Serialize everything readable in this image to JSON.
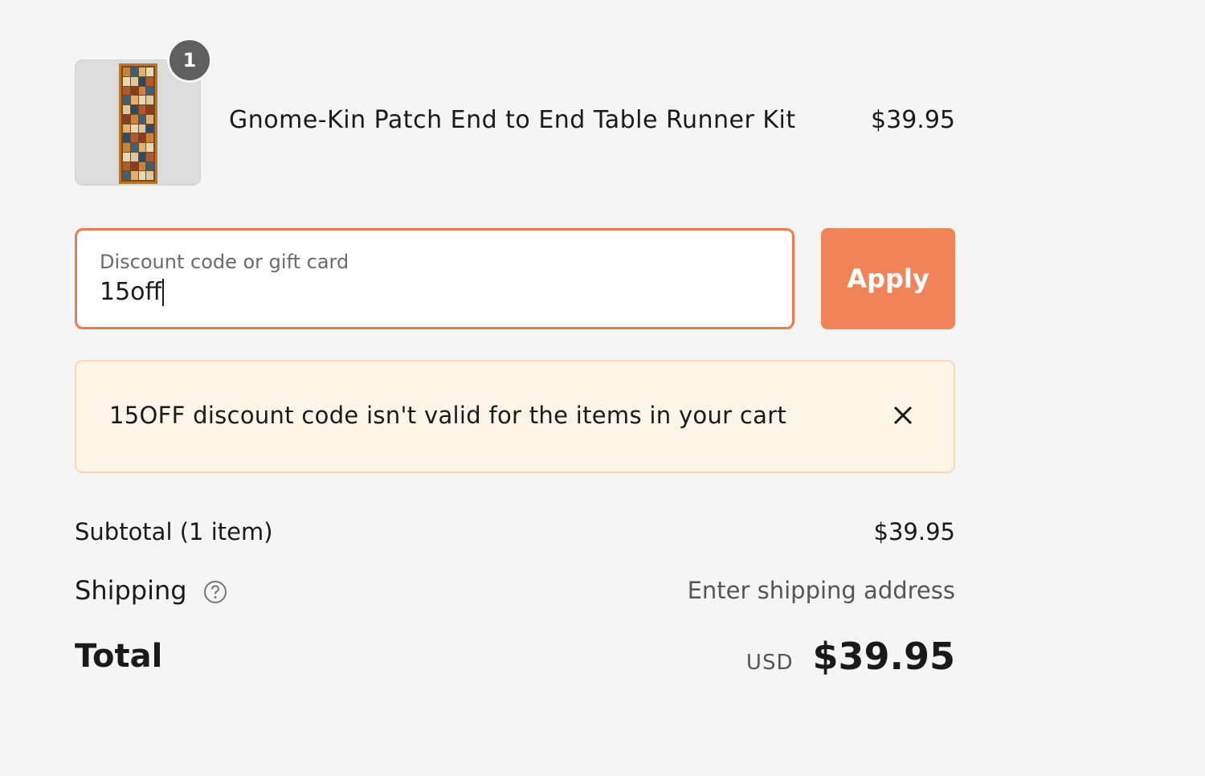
{
  "line_item": {
    "quantity": "1",
    "title": "Gnome-Kin Patch End to End Table Runner Kit",
    "price": "$39.95"
  },
  "discount": {
    "label": "Discount code or gift card",
    "value": "15off",
    "apply_label": "Apply"
  },
  "error": {
    "message": "15OFF discount code isn't valid for the items in your cart"
  },
  "totals": {
    "subtotal_label": "Subtotal (1 item)",
    "subtotal_value": "$39.95",
    "shipping_label": "Shipping",
    "shipping_value": "Enter shipping address",
    "total_label": "Total",
    "currency": "USD",
    "total_value": "$39.95"
  },
  "colors": {
    "accent": "#f08458",
    "focus_border": "#ee7a4e",
    "error_background": "#fff4e8",
    "error_border": "#f8d9b4",
    "badge": "#5f5f5f"
  },
  "icons": {
    "close": "close-icon",
    "help": "question-circle-icon"
  }
}
